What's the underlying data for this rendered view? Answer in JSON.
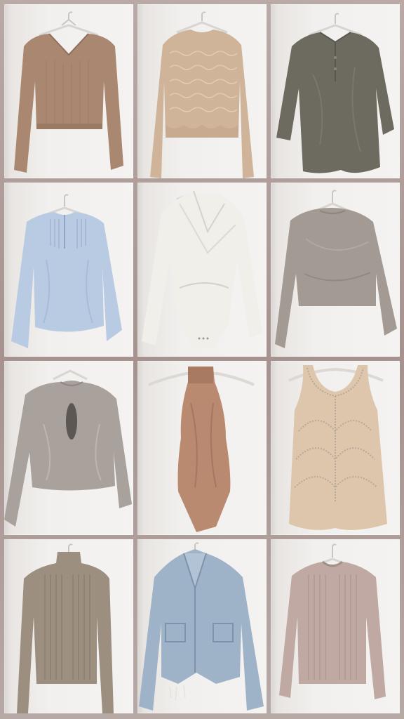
{
  "collage": {
    "tiles": [
      {
        "item": "v-neck-ribbed-crop-sweater",
        "color": "#a98770"
      },
      {
        "item": "pointelle-knit-crop-sweater",
        "color": "#cfb49a"
      },
      {
        "item": "satin-henley-blouse",
        "color": "#6d6b60"
      },
      {
        "item": "pintuck-peasant-blouse",
        "color": "#b9cbe3"
      },
      {
        "item": "wrap-front-bodysuit",
        "color": "#f1efe9"
      },
      {
        "item": "satin-crop-top",
        "color": "#a39a94"
      },
      {
        "item": "keyhole-satin-blouse",
        "color": "#a8a19c"
      },
      {
        "item": "halter-neck-bodysuit",
        "color": "#b98a70"
      },
      {
        "item": "sequin-chiffon-tank",
        "color": "#ddc6ac"
      },
      {
        "item": "cable-knit-turtleneck",
        "color": "#9c8f7f"
      },
      {
        "item": "cropped-denim-jacket",
        "color": "#9fb3c8"
      },
      {
        "item": "ribbed-crew-neck-sweater",
        "color": "#c0a9a2"
      }
    ]
  }
}
